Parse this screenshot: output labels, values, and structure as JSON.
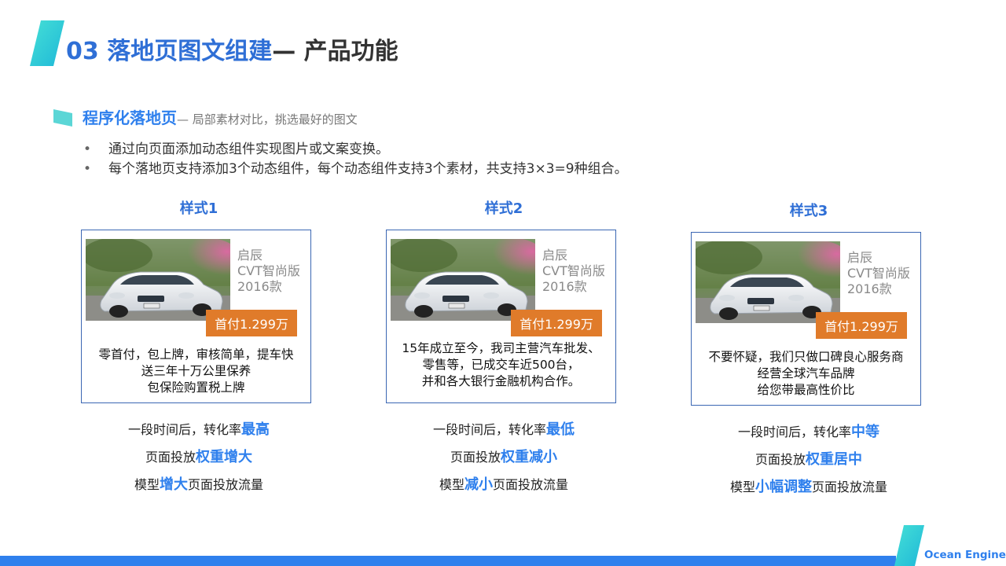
{
  "header": {
    "number": "03",
    "title": "落地页图文组建",
    "subtitle": "— 产品功能"
  },
  "section": {
    "heading": "程序化落地页",
    "heading_sub": "— 局部素材对比，挑选最好的图文",
    "bullets": [
      "通过向页面添加动态组件实现图片或文案变换。",
      "每个落地页支持添加3个动态组件，每个动态组件支持3个素材，共支持3×3=9种组合。"
    ]
  },
  "styles": [
    {
      "title": "样式1",
      "car_info": [
        "启辰",
        "CVT智尚版",
        "2016款"
      ],
      "price": "首付1.299万",
      "desc": [
        "零首付，包上牌，审核简单，提车快",
        "送三年十万公里保养",
        "包保险购置税上牌"
      ],
      "result_line1": {
        "pre": "一段时间后，转化率",
        "hl": "最高",
        "post": ""
      },
      "result_line2": {
        "pre": "页面投放",
        "hl": "权重增大",
        "post": ""
      },
      "result_line3": {
        "pre": "模型",
        "hl": "增大",
        "post": "页面投放流量"
      }
    },
    {
      "title": "样式2",
      "car_info": [
        "启辰",
        "CVT智尚版",
        "2016款"
      ],
      "price": "首付1.299万",
      "desc": [
        "15年成立至今，我司主营汽车批发、",
        "零售等，已成交车近500台，",
        "并和各大银行金融机构合作。"
      ],
      "result_line1": {
        "pre": "一段时间后，转化率",
        "hl": "最低",
        "post": ""
      },
      "result_line2": {
        "pre": "页面投放",
        "hl": "权重减小",
        "post": ""
      },
      "result_line3": {
        "pre": "模型",
        "hl": "减小",
        "post": "页面投放流量"
      }
    },
    {
      "title": "样式3",
      "car_info": [
        "启辰",
        "CVT智尚版",
        "2016款"
      ],
      "price": "首付1.299万",
      "desc": [
        "不要怀疑，我们只做口碑良心服务商",
        "经营全球汽车品牌",
        "给您带最高性价比"
      ],
      "result_line1": {
        "pre": "一段时间后，转化率",
        "hl": "中等",
        "post": ""
      },
      "result_line2": {
        "pre": "页面投放",
        "hl": "权重居中",
        "post": ""
      },
      "result_line3": {
        "pre": "模型",
        "hl": "小幅调整",
        "post": "页面投放流量"
      }
    }
  ],
  "footer": {
    "brand": "Ocean Engine"
  },
  "colors": {
    "title_blue": "#2f6fd6",
    "accent_blue": "#2f80ed",
    "accent_teal": "#3ad0d8",
    "price_orange": "#e07b2a",
    "card_border": "#3b67b3"
  }
}
